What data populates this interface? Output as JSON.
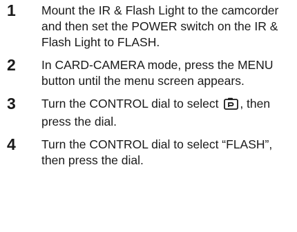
{
  "steps": [
    {
      "number": "1",
      "text": "Mount the IR & Flash Light to the camcorder and then set the POWER switch on the IR & Flash Light to FLASH."
    },
    {
      "number": "2",
      "text": "In CARD-CAMERA mode, press the MENU button until the menu screen appears."
    },
    {
      "number": "3",
      "text_before": "Turn the CONTROL dial to select",
      "icon": "camera-settings-icon",
      "text_after": ", then press the dial."
    },
    {
      "number": "4",
      "text": "Turn the CONTROL dial to select “FLASH”, then press the dial."
    }
  ]
}
